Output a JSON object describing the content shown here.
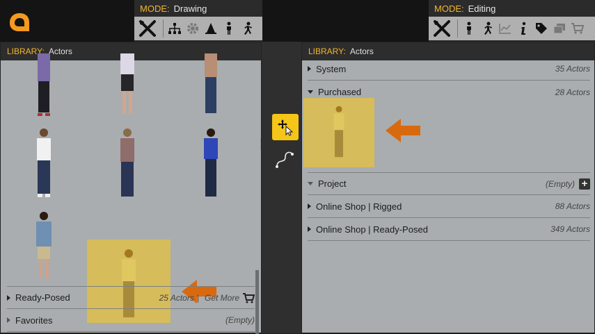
{
  "left_mode": {
    "label": "MODE:",
    "value": "Drawing"
  },
  "right_mode": {
    "label": "MODE:",
    "value": "Editing"
  },
  "left_tools": [
    "tools-icon",
    "hierarchy-icon",
    "gear-icon",
    "cone-icon",
    "person-icon",
    "run-icon"
  ],
  "right_tools": [
    "tools-icon",
    "person-icon",
    "run-icon",
    "chart-icon",
    "info-icon",
    "tag-icon",
    "gallery-icon",
    "cart-icon"
  ],
  "left_library": {
    "label": "LIBRARY:",
    "value": "Actors",
    "rows": [
      {
        "name": "Ready-Posed",
        "count": "25 Actors",
        "extra": "Get More"
      },
      {
        "name": "Favorites",
        "count": "(Empty)"
      }
    ]
  },
  "right_library": {
    "label": "LIBRARY:",
    "value": "Actors",
    "rows": [
      {
        "name": "System",
        "count": "35 Actors"
      },
      {
        "name": "Purchased",
        "count": "28 Actors"
      },
      {
        "name": "Project",
        "count": "(Empty)"
      },
      {
        "name": "Online Shop | Rigged",
        "count": "88 Actors"
      },
      {
        "name": "Online Shop | Ready-Posed",
        "count": "349 Actors"
      }
    ]
  },
  "colors": {
    "accent": "#f5b62a",
    "selection": "#d6bc5a",
    "arrow": "#d9690f",
    "panel": "#a9adaf"
  }
}
